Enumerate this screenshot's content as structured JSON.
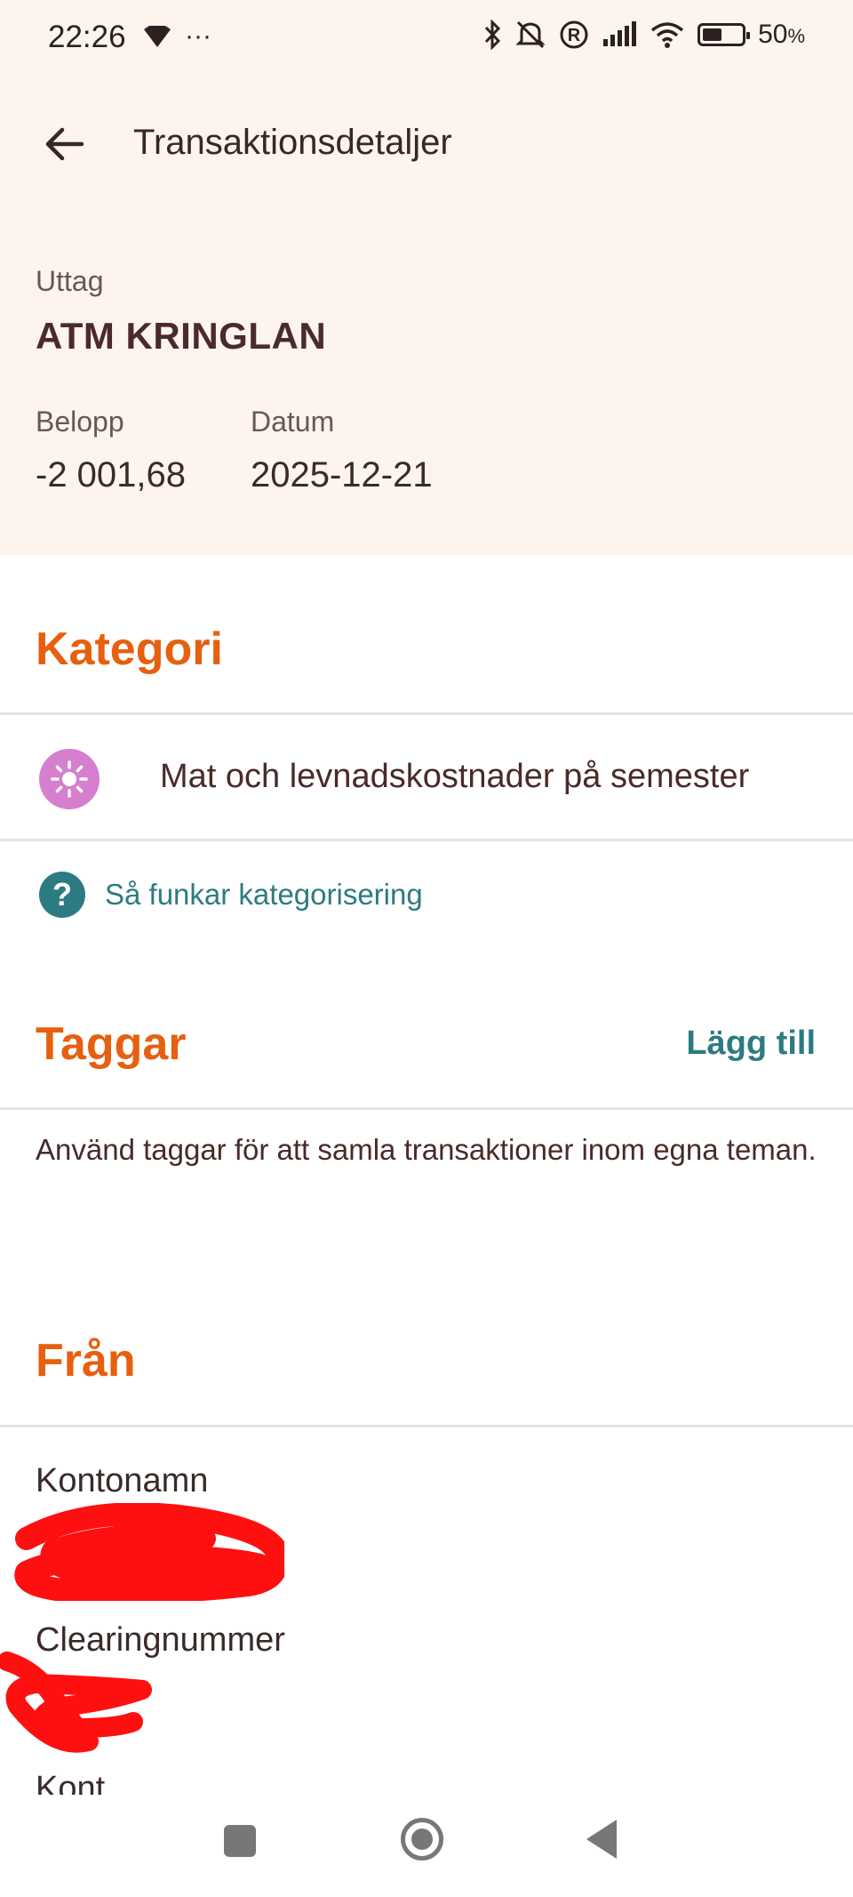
{
  "status_bar": {
    "time": "22:26",
    "more_icon": "···",
    "battery_percent_text": "50",
    "battery_percent_symbol": "%",
    "battery_level": 0.5,
    "icons_left": [
      "location-diamond-icon",
      "more-dots-icon"
    ],
    "icons_right": [
      "bluetooth-icon",
      "mute-icon",
      "registered-icon",
      "signal-icon",
      "wifi-icon",
      "battery-icon"
    ]
  },
  "appbar": {
    "title": "Transaktionsdetaljer",
    "back_icon": "back-arrow-icon"
  },
  "transaction": {
    "type": "Uttag",
    "merchant": "ATM KRINGLAN",
    "amount_label": "Belopp",
    "amount": "-2 001,68",
    "date_label": "Datum",
    "date": "2025-12-21"
  },
  "category": {
    "section_title": "Kategori",
    "icon": "sun-icon",
    "icon_color": "#d57fce",
    "label": "Mat och levnadskostnader på semester",
    "help_text": "Så funkar kategorisering",
    "help_icon": "question-icon"
  },
  "tags": {
    "section_title": "Taggar",
    "add_label": "Lägg till",
    "help_text": "Använd taggar för att samla transaktioner inom egna teman."
  },
  "from": {
    "section_title": "Från",
    "account_name_label": "Kontonamn",
    "clearing_label": "Clearingnummer",
    "next_label_partial": "Kont"
  },
  "colors": {
    "accent_orange": "#e6600f",
    "teal": "#2d7b82",
    "header_bg": "#fcf4ed",
    "redaction_red": "#ff0000"
  },
  "navbar": {
    "buttons": [
      "recent-apps-square-icon",
      "home-circle-icon",
      "back-triangle-icon"
    ]
  }
}
